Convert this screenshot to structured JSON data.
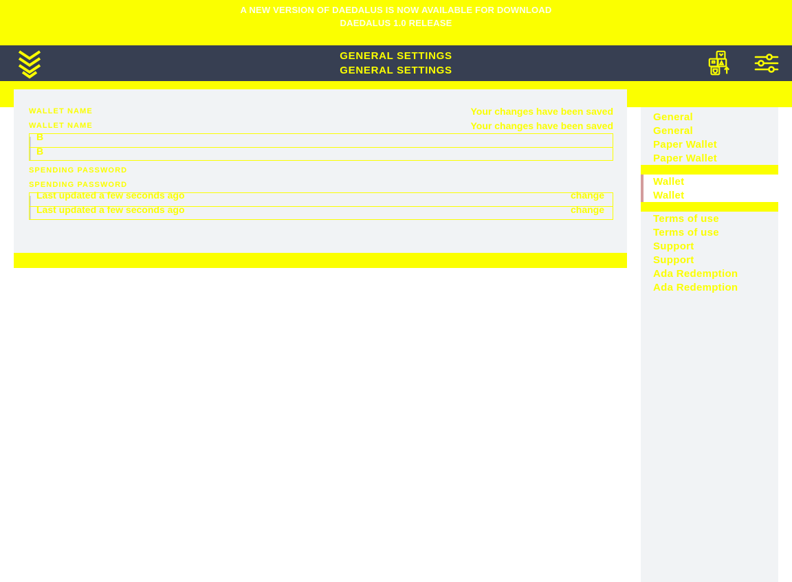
{
  "news_banner": {
    "line1": "A NEW VERSION OF DAEDALUS IS NOW AVAILABLE FOR DOWNLOAD",
    "line2": "DAEDALUS 1.0 RELEASE"
  },
  "topbar": {
    "title": "GENERAL SETTINGS",
    "title_dup": "GENERAL SETTINGS",
    "logo_icon": "daedalus-chevron-logo",
    "wallets_icon": "wallets-grid-icon",
    "settings_icon": "settings-sliders-icon"
  },
  "settings": {
    "wallet_name": {
      "label": "WALLET NAME",
      "label_dup": "WALLET NAME",
      "value": "B",
      "value_dup": "B",
      "saved_message": "Your changes have been saved",
      "saved_message_dup": "Your changes have been saved"
    },
    "spending_password": {
      "label": "SPENDING PASSWORD",
      "label_dup": "SPENDING PASSWORD",
      "last_updated": "Last updated a few seconds ago",
      "last_updated_dup": "Last updated a few seconds ago",
      "change_label": "change",
      "change_label_dup": "change"
    }
  },
  "sidebar": {
    "items": [
      {
        "label": "General",
        "active": false
      },
      {
        "label": "General",
        "active": false
      },
      {
        "label": "Paper Wallet",
        "active": false
      },
      {
        "label": "Paper Wallet",
        "active": false
      },
      {
        "label": "Wallet",
        "active": true
      },
      {
        "label": "Wallet",
        "active": true
      },
      {
        "label": "Terms of use",
        "active": false
      },
      {
        "label": "Terms of use",
        "active": false
      },
      {
        "label": "Support",
        "active": false
      },
      {
        "label": "Support",
        "active": false
      },
      {
        "label": "Ada Redemption",
        "active": false
      },
      {
        "label": "Ada Redemption",
        "active": false
      }
    ]
  },
  "colors": {
    "accent_yellow": "#fbff00",
    "topbar_navy": "#373f52",
    "panel_gray": "#f1f3f5",
    "active_marker": "#d39c9c"
  }
}
